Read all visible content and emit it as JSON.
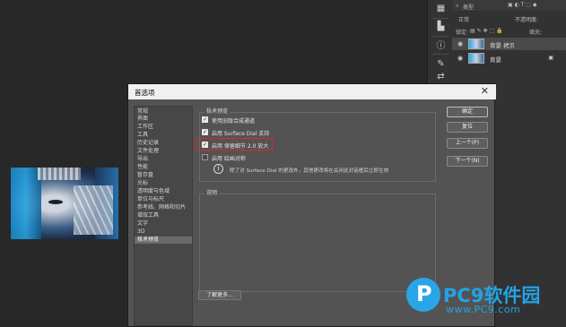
{
  "colors": {
    "accent_red": "#e0252b",
    "watermark_blue": "#22a3e6",
    "dialog_bg": "#535353"
  },
  "layers_panel": {
    "search_placeholder": "类型",
    "blend_mode": "正常",
    "opacity_label": "不透明度:",
    "lock_label": "锁定:",
    "fill_label": "填充:",
    "layers": [
      {
        "name": "背景 拷贝",
        "visible": true,
        "locked": false
      },
      {
        "name": "背景",
        "visible": true,
        "locked": true
      }
    ]
  },
  "dialog": {
    "title": "首选项",
    "close_label": "✕",
    "categories": [
      "常规",
      "界面",
      "工作区",
      "工具",
      "历史记录",
      "文件处理",
      "导出",
      "性能",
      "暂存盘",
      "光标",
      "透明度与色域",
      "单位与标尺",
      "参考线、网格和切片",
      "增效工具",
      "文字",
      "3D",
      "技术预览"
    ],
    "selected_category": "技术预览",
    "tech_section": {
      "legend": "技术预览",
      "options": [
        {
          "label": "使用旧版合成通道",
          "checked": true
        },
        {
          "label": "启用 Surface Dial 支持",
          "checked": true
        },
        {
          "label": "启用 保留细节 2.0 放大",
          "checked": true
        },
        {
          "label": "启用 绘画对称",
          "checked": false
        }
      ],
      "info_text": "除了对 Surface Dial 的更改外，其他更改将在关闭此对话框后立即生效"
    },
    "desc_section": {
      "legend": "说明"
    },
    "learn_more": "了解更多...",
    "buttons": {
      "ok": "确定",
      "reset": "复位",
      "prev": "上一个(P)",
      "next": "下一个(N)"
    }
  },
  "watermark": {
    "logo_letter": "P",
    "brand": "PC9软件园",
    "url": "www.PC9.com"
  }
}
